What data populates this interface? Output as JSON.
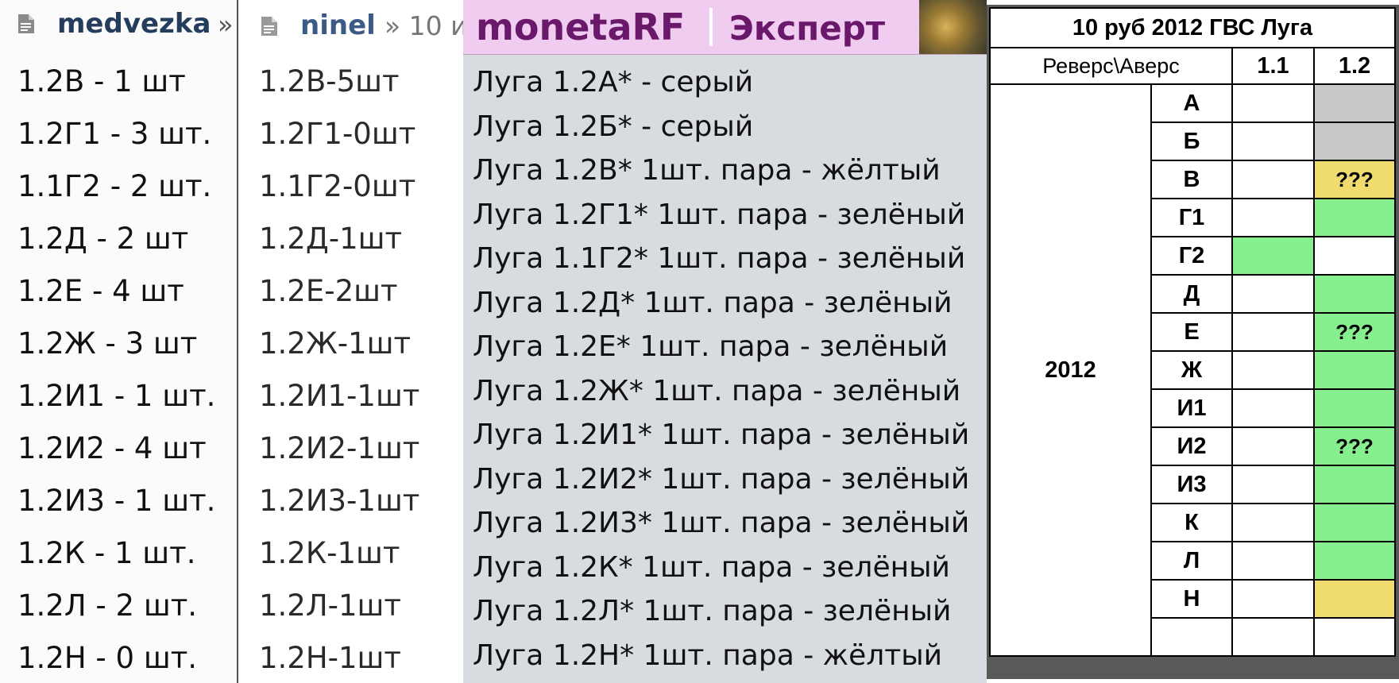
{
  "panel_medvezka": {
    "username": "medvezka",
    "separator": "»",
    "folder_icon": "file-icon",
    "items": [
      "1.2В - 1 шт",
      "1.2Г1 - 3 шт.",
      "1.1Г2 - 2 шт.",
      "1.2Д - 2 шт",
      "1.2Е - 4 шт",
      "1.2Ж - 3 шт",
      "1.2И1 - 1 шт.",
      "1.2И2 - 4 шт",
      "1.2И3 - 1 шт.",
      "1.2К - 1 шт.",
      "1.2Л - 2 шт.",
      "1.2Н - 0 шт."
    ]
  },
  "panel_ninel": {
    "username": "ninel",
    "breadcrumb": "» 10 и",
    "folder_icon": "file-icon",
    "items": [
      "1.2В-5шт",
      "1.2Г1-0шт",
      "1.1Г2-0шт",
      "1.2Д-1шт",
      "1.2Е-2шт",
      "1.2Ж-1шт",
      "1.2И1-1шт",
      "1.2И2-1шт",
      "1.2И3-1шт",
      "1.2К-1шт",
      "1.2Л-1шт",
      "1.2Н-1шт"
    ]
  },
  "panel_moneta": {
    "logo": "monetaRF",
    "section": "Эксперт",
    "items": [
      "Луга 1.2А* - серый",
      "Луга 1.2Б* - серый",
      "Луга 1.2В* 1шт. пара - жёлтый",
      "Луга 1.2Г1* 1шт. пара - зелёный",
      "Луга 1.1Г2* 1шт. пара - зелёный",
      "Луга 1.2Д* 1шт. пара - зелёный",
      "Луга 1.2Е* 1шт. пара - зелёный",
      "Луга 1.2Ж* 1шт. пара - зелёный",
      "Луга 1.2И1* 1шт. пара - зелёный",
      "Луга 1.2И2* 1шт. пара - зелёный",
      "Луга 1.2И3* 1шт. пара - зелёный",
      "Луга 1.2К* 1шт. пара - зелёный",
      "Луга 1.2Л* 1шт. пара - зелёный",
      "Луга 1.2Н* 1шт. пара - жёлтый"
    ]
  },
  "table": {
    "title": "10 руб 2012 ГВС Луга",
    "header": {
      "rev_avers": "Реверс\\Аверс",
      "col1": "1.1",
      "col2": "1.2"
    },
    "year": "2012",
    "colors": {
      "gray": "#c8c8c8",
      "yellow": "#f0dc6e",
      "green": "#86ef8e",
      "white": "#ffffff"
    },
    "rows": [
      {
        "label": "А",
        "c11": {
          "fill": "white",
          "text": ""
        },
        "c12": {
          "fill": "gray",
          "text": ""
        }
      },
      {
        "label": "Б",
        "c11": {
          "fill": "white",
          "text": ""
        },
        "c12": {
          "fill": "gray",
          "text": ""
        }
      },
      {
        "label": "В",
        "c11": {
          "fill": "white",
          "text": ""
        },
        "c12": {
          "fill": "yellow",
          "text": "???"
        }
      },
      {
        "label": "Г1",
        "c11": {
          "fill": "white",
          "text": ""
        },
        "c12": {
          "fill": "green",
          "text": ""
        }
      },
      {
        "label": "Г2",
        "c11": {
          "fill": "green",
          "text": ""
        },
        "c12": {
          "fill": "white",
          "text": ""
        }
      },
      {
        "label": "Д",
        "c11": {
          "fill": "white",
          "text": ""
        },
        "c12": {
          "fill": "green",
          "text": ""
        }
      },
      {
        "label": "Е",
        "c11": {
          "fill": "white",
          "text": ""
        },
        "c12": {
          "fill": "green",
          "text": "???"
        }
      },
      {
        "label": "Ж",
        "c11": {
          "fill": "white",
          "text": ""
        },
        "c12": {
          "fill": "green",
          "text": ""
        }
      },
      {
        "label": "И1",
        "c11": {
          "fill": "white",
          "text": ""
        },
        "c12": {
          "fill": "green",
          "text": ""
        }
      },
      {
        "label": "И2",
        "c11": {
          "fill": "white",
          "text": ""
        },
        "c12": {
          "fill": "green",
          "text": "???"
        }
      },
      {
        "label": "И3",
        "c11": {
          "fill": "white",
          "text": ""
        },
        "c12": {
          "fill": "green",
          "text": ""
        }
      },
      {
        "label": "К",
        "c11": {
          "fill": "white",
          "text": ""
        },
        "c12": {
          "fill": "green",
          "text": ""
        }
      },
      {
        "label": "Л",
        "c11": {
          "fill": "white",
          "text": ""
        },
        "c12": {
          "fill": "green",
          "text": ""
        }
      },
      {
        "label": "Н",
        "c11": {
          "fill": "white",
          "text": ""
        },
        "c12": {
          "fill": "yellow",
          "text": ""
        }
      },
      {
        "label": "",
        "c11": {
          "fill": "white",
          "text": ""
        },
        "c12": {
          "fill": "white",
          "text": ""
        }
      }
    ]
  }
}
